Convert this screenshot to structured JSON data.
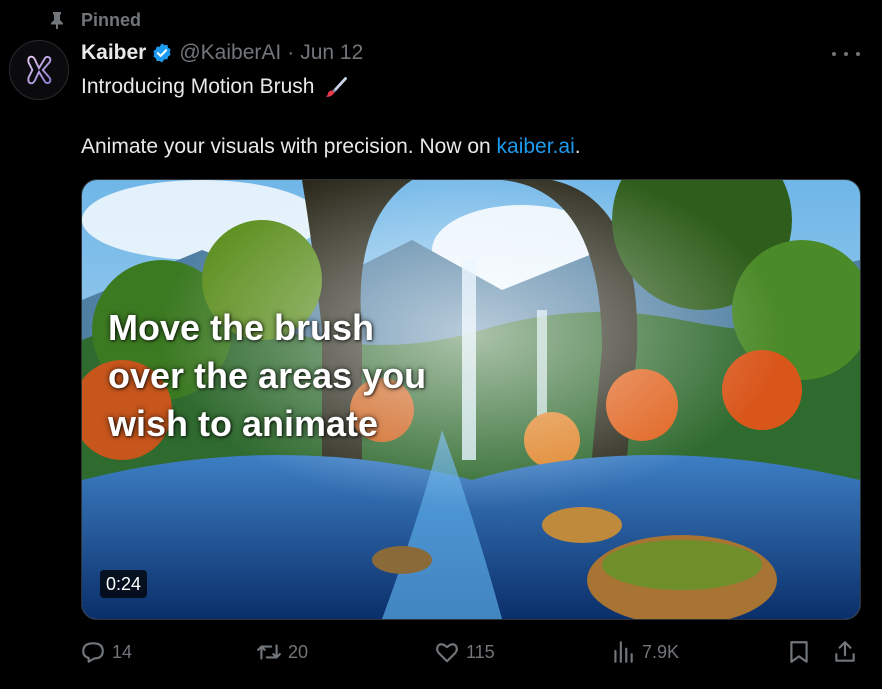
{
  "pinned": {
    "label": "Pinned",
    "icon": "pin-icon"
  },
  "author": {
    "name": "Kaiber",
    "handle": "@KaiberAI",
    "separator": "·",
    "date": "Jun 12",
    "verified_icon": "verified-badge-icon",
    "avatar_icon": "kaiber-logo-icon"
  },
  "body": {
    "line1": "Introducing Motion Brush",
    "line1_emoji": "paintbrush-icon",
    "line2_prefix": "Animate your visuals with precision. Now on ",
    "line2_link": "kaiber.ai",
    "line2_suffix": "."
  },
  "media": {
    "overlay_text": "Move the brush over the areas you wish to animate",
    "duration": "0:24"
  },
  "actions": {
    "replies": "14",
    "retweets": "20",
    "likes": "115",
    "views": "7.9K"
  },
  "colors": {
    "background": "#000000",
    "text": "#e7e9ea",
    "secondary": "#71767b",
    "link": "#1d9bf0",
    "verified": "#1d9bf0"
  }
}
